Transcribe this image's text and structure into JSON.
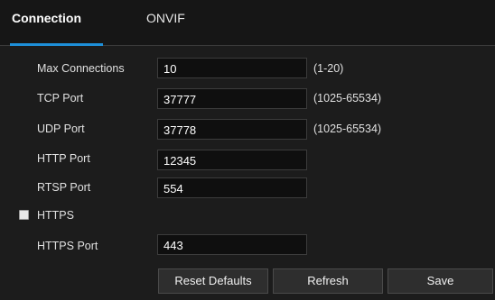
{
  "tabs": [
    {
      "label": "Connection",
      "active": true
    },
    {
      "label": "ONVIF",
      "active": false
    }
  ],
  "accent_color": "#1e8fd8",
  "form": {
    "max_connections": {
      "label": "Max Connections",
      "value": "10",
      "hint": "(1-20)"
    },
    "tcp_port": {
      "label": "TCP Port",
      "value": "37777",
      "hint": "(1025-65534)"
    },
    "udp_port": {
      "label": "UDP Port",
      "value": "37778",
      "hint": "(1025-65534)"
    },
    "http_port": {
      "label": "HTTP Port",
      "value": "12345"
    },
    "rtsp_port": {
      "label": "RTSP Port",
      "value": "554"
    },
    "https": {
      "label": "HTTPS",
      "checked": false
    },
    "https_port": {
      "label": "HTTPS Port",
      "value": "443"
    }
  },
  "buttons": {
    "reset_defaults": "Reset Defaults",
    "refresh": "Refresh",
    "save": "Save"
  }
}
